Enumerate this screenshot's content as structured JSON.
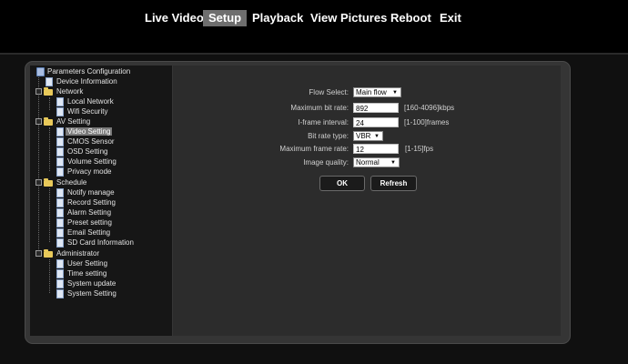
{
  "nav": {
    "items": [
      "Live Video",
      "Setup",
      "Playback",
      "View Pictures",
      "Reboot",
      "Exit"
    ],
    "active": "Setup"
  },
  "tree": {
    "root": "Parameters Configuration",
    "device_information": "Device Information",
    "network": "Network",
    "local_network": "Local Network",
    "wifi_security": "Wifi Security",
    "av_setting": "AV Setting",
    "video_setting": "Video Setting",
    "cmos_sensor": "CMOS Sensor",
    "osd_setting": "OSD Setting",
    "volume_setting": "Volume Setting",
    "privacy_mode": "Privacy mode",
    "schedule": "Schedule",
    "notify_manage": "Notify manage",
    "record_setting": "Record Setting",
    "alarm_setting": "Alarm Setting",
    "preset_setting": "Preset setting",
    "email_setting": "Email Setting",
    "sd_card_information": "SD Card Information",
    "administrator": "Administrator",
    "user_setting": "User Setting",
    "time_setting": "Time setting",
    "system_update": "System update",
    "system_setting": "System Setting",
    "selected": "Video Setting"
  },
  "form": {
    "flow_select": {
      "label": "Flow Select:",
      "value": "Main flow"
    },
    "max_bit_rate": {
      "label": "Maximum bit rate:",
      "value": "892",
      "hint": "[160-4096]kbps"
    },
    "iframe_interval": {
      "label": "I-frame interval:",
      "value": "24",
      "hint": "[1-100]frames"
    },
    "bit_rate_type": {
      "label": "Bit rate type:",
      "value": "VBR"
    },
    "max_frame_rate": {
      "label": "Maximum frame rate:",
      "value": "12",
      "hint": "[1-15]fps"
    },
    "image_quality": {
      "label": "Image quality:",
      "value": "Normal"
    }
  },
  "buttons": {
    "ok": "OK",
    "refresh": "Refresh"
  },
  "colors": {
    "nav_active_bg": "#6e6e6e",
    "folder": "#e8c95a",
    "tree_selected_bg": "#7a7a7a"
  }
}
